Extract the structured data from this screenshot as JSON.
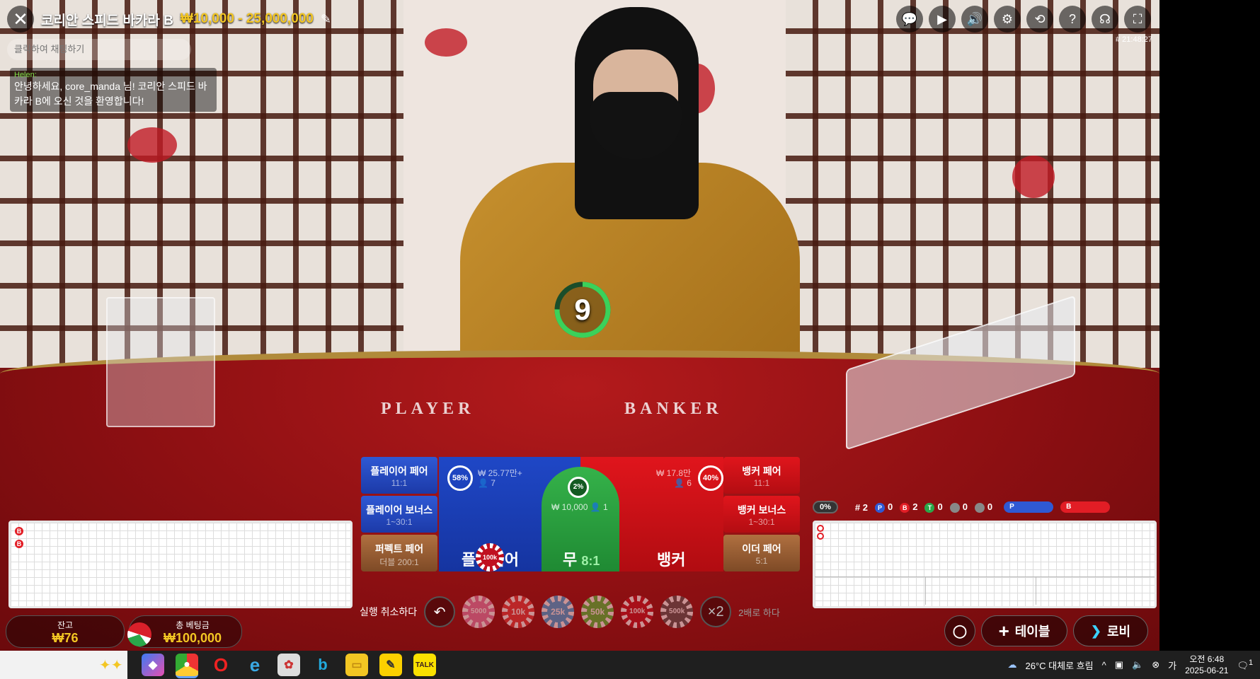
{
  "header": {
    "title": "코리안 스피드 바카라 B",
    "limits": "₩10,000 - 25,000,000",
    "round_time": "# 21:48:27"
  },
  "chat": {
    "placeholder": "클릭하여 채팅하기",
    "user": "Helen:",
    "message": "안녕하세요, core_manda 님! 코리안 스피드 바카라 B에 오신 것을 환영합니다!"
  },
  "timer": {
    "value": "9"
  },
  "felt": {
    "player": "PLAYER",
    "banker": "BANKER"
  },
  "side_bets_left": [
    {
      "label": "플레이어 페어",
      "odds": "11:1"
    },
    {
      "label": "플레이어 보너스",
      "odds": "1~30:1"
    },
    {
      "label": "퍼펙트 페어",
      "odds": "더블 200:1"
    }
  ],
  "side_bets_right": [
    {
      "label": "뱅커 페어",
      "odds": "11:1"
    },
    {
      "label": "뱅커 보너스",
      "odds": "1~30:1"
    },
    {
      "label": "이더 페어",
      "odds": "5:1"
    }
  ],
  "main_bets": {
    "player": {
      "label": "플레이어",
      "pct": "58%",
      "amount": "₩ 25.77만+",
      "players": "7"
    },
    "tie": {
      "label": "무",
      "odds": "8:1",
      "pct": "2%",
      "amount": "₩ 10,000",
      "players": "1"
    },
    "banker": {
      "label": "뱅커",
      "pct": "40%",
      "amount": "₩ 17.8만",
      "players": "6"
    },
    "placed_chip": "100k"
  },
  "stats": {
    "pct": "0%",
    "round": "# 2",
    "p": "0",
    "b": "2",
    "t": "0",
    "pp": "0",
    "bp": "0",
    "p_label": "P",
    "b_label": "B",
    "t_label": "T"
  },
  "controls": {
    "undo_label": "실행 취소하다",
    "chips": [
      "5000",
      "10k",
      "25k",
      "50k",
      "100k",
      "500k"
    ],
    "double": "×2",
    "double_label": "2배로 하다"
  },
  "balance": {
    "label": "잔고",
    "value": "₩76"
  },
  "total_bet": {
    "label": "총 베팅금",
    "value": "₩100,000"
  },
  "buttons": {
    "table": "테이블",
    "lobby": "로비"
  },
  "taskbar": {
    "weather": "26°C 대체로 흐림",
    "time": "오전 6:48",
    "date": "2025-06-21",
    "notif": "1"
  },
  "colors": {
    "player": "#1f47c6",
    "banker": "#e0151c",
    "tie": "#35b24a",
    "gold": "#f3c623"
  }
}
